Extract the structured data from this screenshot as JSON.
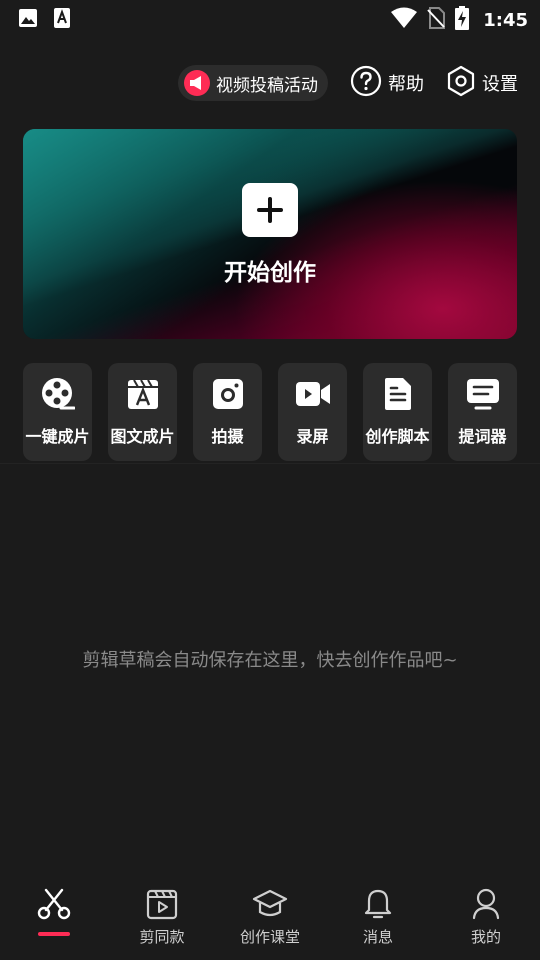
{
  "status_bar": {
    "time": "1:45",
    "left_icons": [
      "image-icon",
      "text-a-icon"
    ],
    "right_icons": [
      "wifi-icon",
      "no-sim-icon",
      "battery-charging-icon"
    ]
  },
  "header": {
    "promo_label": "视频投稿活动",
    "help_label": "帮助",
    "settings_label": "设置"
  },
  "hero": {
    "label": "开始创作",
    "icon": "plus-icon"
  },
  "tools": [
    {
      "label": "一键成片",
      "icon": "film-reel-icon"
    },
    {
      "label": "图文成片",
      "icon": "clapper-text-icon"
    },
    {
      "label": "拍摄",
      "icon": "camera-icon"
    },
    {
      "label": "录屏",
      "icon": "video-record-icon"
    },
    {
      "label": "创作脚本",
      "icon": "document-icon"
    },
    {
      "label": "提词器",
      "icon": "teleprompter-icon"
    }
  ],
  "empty_state": {
    "text": "剪辑草稿会自动保存在这里，快去创作作品吧~"
  },
  "tabbar": {
    "tabs": [
      {
        "label": "",
        "icon": "scissors-icon",
        "active": true
      },
      {
        "label": "剪同款",
        "icon": "video-template-icon",
        "active": false
      },
      {
        "label": "创作课堂",
        "icon": "graduation-cap-icon",
        "active": false
      },
      {
        "label": "消息",
        "icon": "bell-icon",
        "active": false
      },
      {
        "label": "我的",
        "icon": "profile-icon",
        "active": false
      }
    ]
  },
  "colors": {
    "background": "#1b1b1b",
    "card": "#2c2c2c",
    "accent": "#fe2c55",
    "muted_text": "#8a8a8a"
  }
}
